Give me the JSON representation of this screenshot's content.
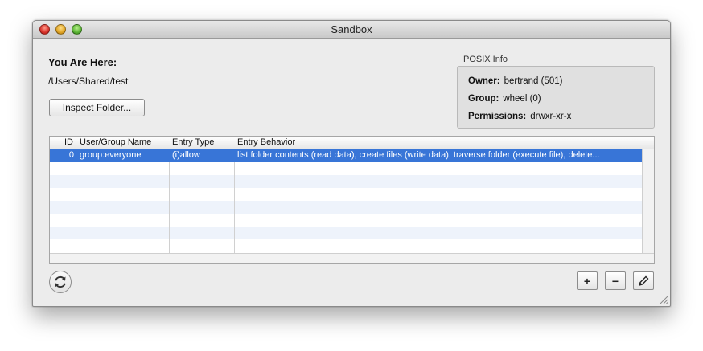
{
  "window": {
    "title": "Sandbox"
  },
  "location": {
    "heading": "You Are Here:",
    "path": "/Users/Shared/test",
    "inspect_button": "Inspect Folder..."
  },
  "posix": {
    "caption": "POSIX Info",
    "owner_label": "Owner:",
    "owner_value": "bertrand (501)",
    "group_label": "Group:",
    "group_value": "wheel (0)",
    "permissions_label": "Permissions:",
    "permissions_value": "drwxr-xr-x"
  },
  "acl_table": {
    "columns": [
      "ID",
      "User/Group Name",
      "Entry Type",
      "Entry Behavior"
    ],
    "rows": [
      {
        "id": "0",
        "name": "group:everyone",
        "type": "(i)allow",
        "behavior": "list folder contents (read data), create files (write data), traverse folder (execute file), delete..."
      }
    ],
    "selected_row": 0
  },
  "toolbar": {
    "refresh_icon": "refresh-icon",
    "add_label": "+",
    "remove_label": "−",
    "edit_icon": "pencil-icon"
  },
  "colors": {
    "selection": "#3875d7",
    "stripe": "#eef3fb"
  }
}
